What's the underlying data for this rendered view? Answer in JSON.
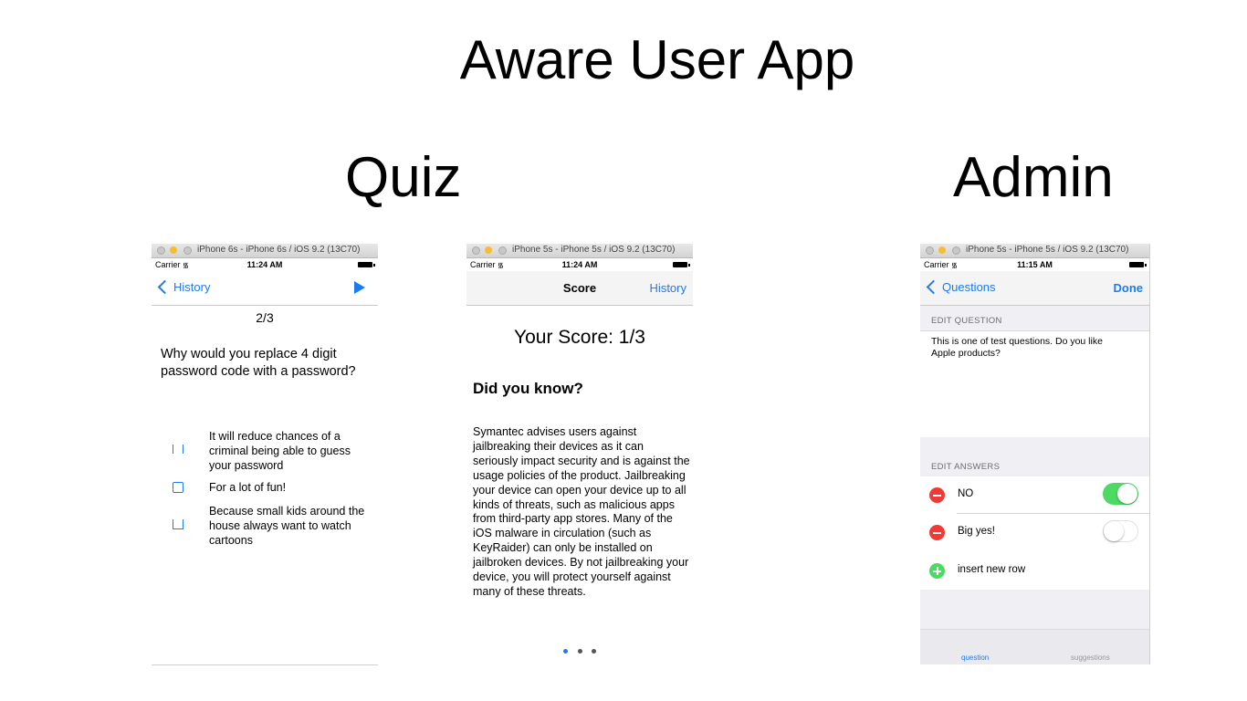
{
  "slide": {
    "title": "Aware User App",
    "sections": {
      "quiz": "Quiz",
      "admin": "Admin"
    }
  },
  "simulators": [
    {
      "window_title": "iPhone 6s - iPhone 6s / iOS 9.2 (13C70)",
      "status": {
        "carrier": "Carrier",
        "time": "11:24 AM"
      },
      "nav": {
        "back_label": "History",
        "right_icon": "play-icon"
      },
      "progress": "2/3",
      "question": "Why would you replace 4 digit password code with a password?",
      "answers": [
        {
          "text": "It will reduce chances of a criminal being able to guess your password"
        },
        {
          "text": "For a lot of fun!"
        },
        {
          "text": "Because small kids around the house always want to watch cartoons"
        }
      ]
    },
    {
      "window_title": "iPhone 5s - iPhone 5s / iOS 9.2 (13C70)",
      "status": {
        "carrier": "Carrier",
        "time": "11:24 AM"
      },
      "nav": {
        "title": "Score",
        "right_label": "History"
      },
      "score": "Your Score: 1/3",
      "heading": "Did you know?",
      "fact": "Symantec advises users against jailbreaking their devices as it can seriously impact security and is against the usage policies of the product. Jailbreaking your device can open your device up to all kinds of threats, such as malicious apps from third-party app stores. Many of the iOS malware in circulation (such as KeyRaider) can only be installed on jailbroken devices. By not jailbreaking your device, you will protect yourself against many of these threats.",
      "page_indicator": {
        "pages": 3,
        "current": 1
      }
    },
    {
      "window_title": "iPhone 5s - iPhone 5s / iOS 9.2 (13C70)",
      "status": {
        "carrier": "Carrier",
        "time": "11:15 AM"
      },
      "nav": {
        "back_label": "Questions",
        "right_label": "Done"
      },
      "edit_question_header": "EDIT QUESTION",
      "question_text": "This is one of test questions. Do you like Apple products?",
      "edit_answers_header": "EDIT ANSWERS",
      "answers": [
        {
          "label": "NO",
          "toggle_on": true
        },
        {
          "label": "Big yes!",
          "toggle_on": false
        }
      ],
      "insert_row_label": "insert new row",
      "tabs": [
        "question",
        "suggestions"
      ],
      "colors": {
        "accent": "#1a7cf5",
        "toggle_on": "#4cd964",
        "delete": "#ef3a35"
      }
    }
  ]
}
